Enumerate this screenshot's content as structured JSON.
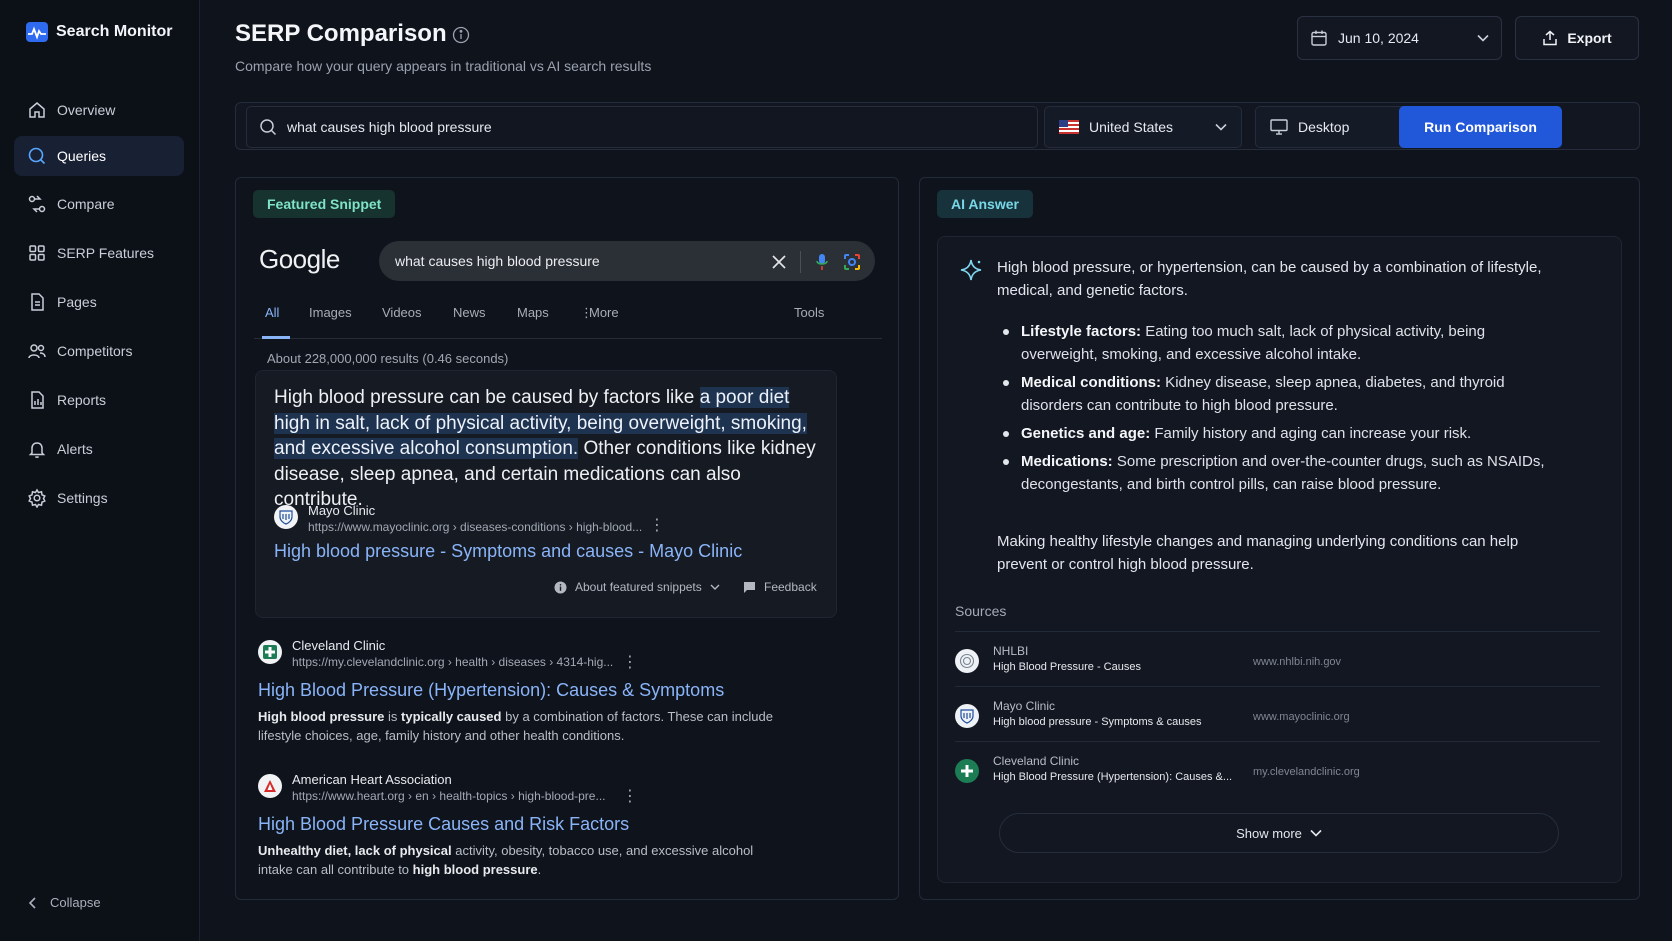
{
  "app": {
    "name": "Search Monitor"
  },
  "sidebar": {
    "items": [
      {
        "label": "Overview",
        "icon": "home-icon"
      },
      {
        "label": "Queries",
        "icon": "search-icon",
        "active": true
      },
      {
        "label": "Compare",
        "icon": "compare-icon"
      },
      {
        "label": "SERP Features",
        "icon": "grid-icon"
      },
      {
        "label": "Pages",
        "icon": "document-icon"
      },
      {
        "label": "Competitors",
        "icon": "users-icon"
      },
      {
        "label": "Reports",
        "icon": "report-icon"
      },
      {
        "label": "Alerts",
        "icon": "bell-icon"
      },
      {
        "label": "Settings",
        "icon": "gear-icon"
      }
    ],
    "collapse_label": "Collapse"
  },
  "header": {
    "title": "SERP Comparison",
    "subtitle": "Compare how your query appears in traditional vs AI search results",
    "date": "Jun 10, 2024",
    "export_label": "Export"
  },
  "query_bar": {
    "query": "what causes high blood pressure",
    "country": "United States",
    "device": "Desktop",
    "run_label": "Run Comparison"
  },
  "left_panel": {
    "tag": "Featured Snippet",
    "google": {
      "logo": "Google",
      "query": "what causes high blood pressure",
      "tabs": [
        "All",
        "Images",
        "Videos",
        "News",
        "Maps",
        "More",
        "Tools"
      ],
      "result_count": "About 228,000,000 results (0.46 seconds)"
    },
    "snippet": {
      "text_before": "High blood pressure can be caused by factors like ",
      "highlight": "a poor diet high in salt, lack of physical activity, being overweight, smoking, and excessive alcohol consumption.",
      "text_after": " Other conditions like kidney disease, sleep apnea, and certain medications can also contribute.",
      "source_name": "Mayo Clinic",
      "source_url": "https://www.mayoclinic.org › diseases-conditions › high-blood...",
      "link": "High blood pressure - Symptoms and causes - Mayo Clinic",
      "about_label": "About featured snippets",
      "feedback_label": "Feedback"
    },
    "results": [
      {
        "source_name": "Cleveland Clinic",
        "source_url": "https://my.clevelandclinic.org › health › diseases › 4314-hig...",
        "link": "High Blood Pressure (Hypertension): Causes & Symptoms",
        "desc_b1": "High blood pressure",
        "desc_t1": " is ",
        "desc_b2": "typically caused",
        "desc_t2": " by a combination of factors. These can include lifestyle choices, age, family history and other health conditions."
      },
      {
        "source_name": "American Heart Association",
        "source_url": "https://www.heart.org › en › health-topics › high-blood-pre...",
        "link": "High Blood Pressure Causes and Risk Factors",
        "desc_b1": "Unhealthy diet, lack of physical",
        "desc_t1": " activity, obesity, tobacco use, and excessive alcohol intake can all contribute to ",
        "desc_b2": "high blood pressure",
        "desc_t2": "."
      }
    ]
  },
  "right_panel": {
    "tag": "AI Answer",
    "intro": "High blood pressure, or hypertension, can be caused by a combination of lifestyle, medical, and genetic factors.",
    "bullets": [
      {
        "term": "Lifestyle factors:",
        "text": " Eating too much salt, lack of physical activity, being overweight, smoking, and excessive alcohol intake."
      },
      {
        "term": "Medical conditions:",
        "text": " Kidney disease, sleep apnea, diabetes, and thyroid disorders can contribute to high blood pressure."
      },
      {
        "term": "Genetics and age:",
        "text": " Family history and aging can increase your risk."
      },
      {
        "term": "Medications:",
        "text": " Some prescription and over-the-counter drugs, such as NSAIDs, decongestants, and birth control pills, can raise blood pressure."
      }
    ],
    "outro": "Making healthy lifestyle changes and managing underlying conditions can help prevent or control high blood pressure.",
    "sources_title": "Sources",
    "sources": [
      {
        "name": "NHLBI",
        "title": "High Blood Pressure - Causes",
        "domain": "www.nhlbi.nih.gov"
      },
      {
        "name": "Mayo Clinic",
        "title": "High blood pressure - Symptoms & causes",
        "domain": "www.mayoclinic.org"
      },
      {
        "name": "Cleveland Clinic",
        "title": "High Blood Pressure (Hypertension): Causes &...",
        "domain": "my.clevelandclinic.org"
      }
    ],
    "show_more_label": "Show more"
  },
  "colors": {
    "accent": "#2158d9",
    "link": "#8ab4f8",
    "snippet_tag": "#7fe3c8",
    "ai_tag": "#78d7e6"
  }
}
